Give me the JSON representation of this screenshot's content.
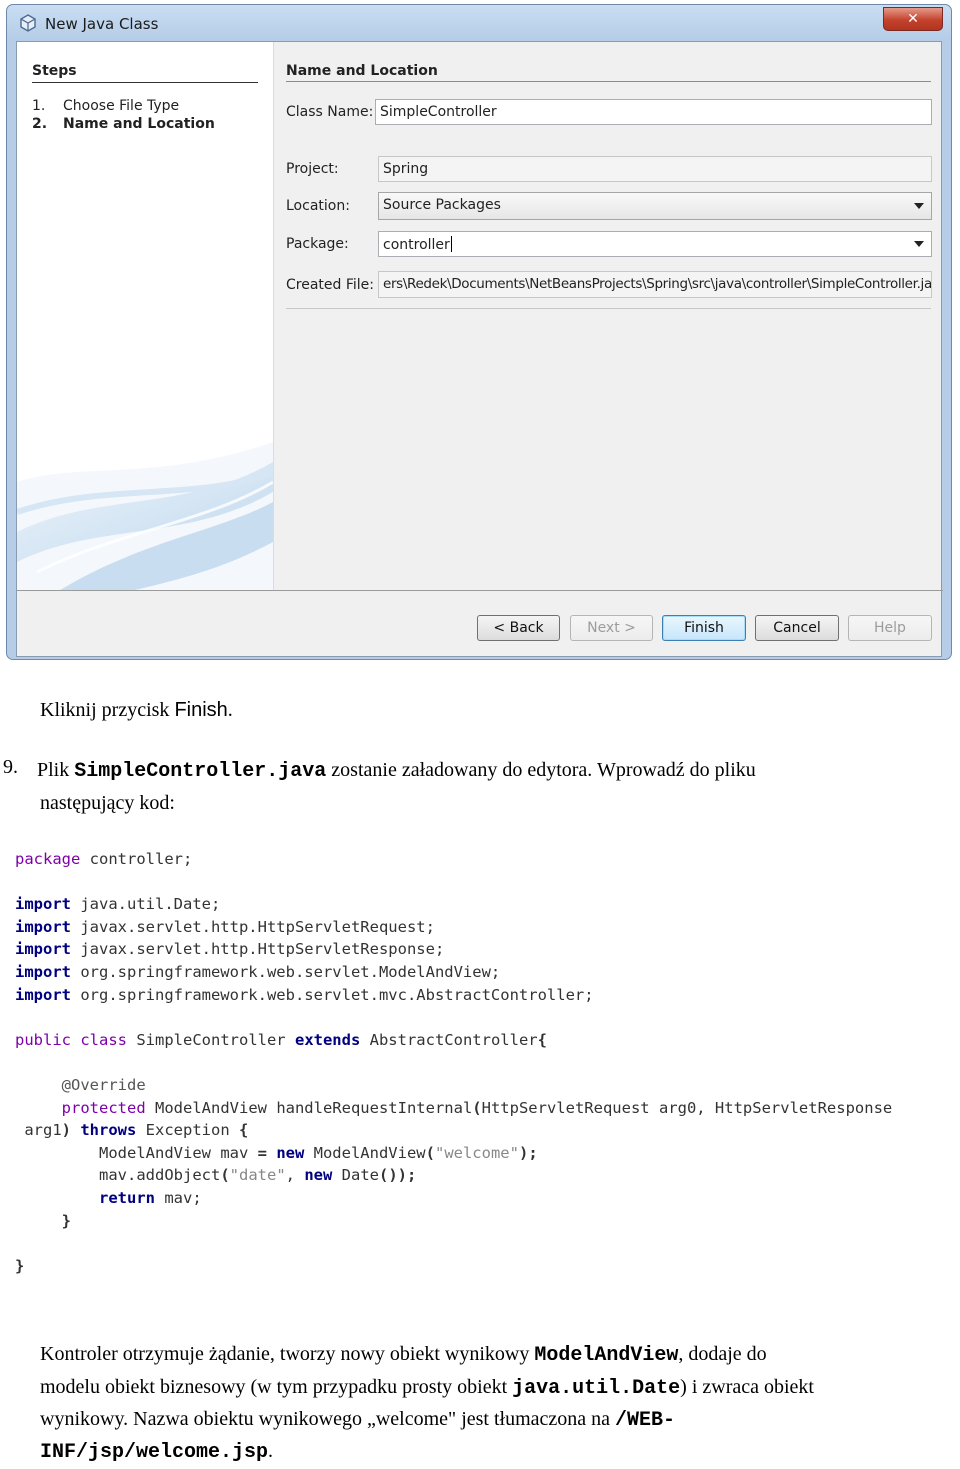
{
  "dialog": {
    "title": "New Java Class",
    "close_label": "✕",
    "steps_heading": "Steps",
    "steps": [
      {
        "num": "1.",
        "label": "Choose File Type"
      },
      {
        "num": "2.",
        "label": "Name and Location"
      }
    ],
    "section_heading": "Name and Location",
    "fields": {
      "class_name": {
        "label": "Class Name:",
        "value": "SimpleController"
      },
      "project": {
        "label": "Project:",
        "value": "Spring"
      },
      "location": {
        "label": "Location:",
        "value": "Source Packages"
      },
      "package": {
        "label": "Package:",
        "value": "controller"
      },
      "created_file": {
        "label": "Created File:",
        "value": "ers\\Redek\\Documents\\NetBeansProjects\\Spring\\src\\java\\controller\\SimpleController.java"
      }
    },
    "buttons": {
      "back": "< Back",
      "next": "Next >",
      "finish": "Finish",
      "cancel": "Cancel",
      "help": "Help"
    }
  },
  "doc": {
    "instruction_pre": "Kliknij przycisk ",
    "instruction_button": "Finish",
    "instruction_post": ".",
    "step_number": "9.",
    "step9_a": "Plik ",
    "step9_file": "SimpleController.java",
    "step9_b": " zostanie załadowany do edytora. Wprowadź do pliku",
    "step9_c": "następujący kod:",
    "code": {
      "l1_kw": "package",
      "l1_rest": " controller;",
      "import_kw": "import",
      "imports": [
        " java.util.Date;",
        " javax.servlet.http.HttpServletRequest;",
        " javax.servlet.http.HttpServletResponse;",
        " org.springframework.web.servlet.ModelAndView;",
        " org.springframework.web.servlet.mvc.AbstractController;"
      ],
      "cls_public": "public",
      "cls_class": " class",
      "cls_name": " SimpleController ",
      "cls_extends": "extends",
      "cls_parent": " AbstractController",
      "cls_brace": "{",
      "annotation": "@Override",
      "m_protected": "protected",
      "m_sig": " ModelAndView handleRequestInternal",
      "m_paren": "(",
      "m_params": "HttpServletRequest arg0, HttpServletResponse",
      "m_arg1": "arg1",
      "m_close": ")",
      "m_throws": " throws",
      "m_exc": " Exception ",
      "m_open": "{",
      "b1_a": "ModelAndView mav ",
      "b1_eq": "=",
      "b1_new": " new",
      "b1_b": " ModelAndView",
      "b1_po": "(",
      "b1_str": "\"welcome\"",
      "b1_end": ");",
      "b2_a": "mav.addObject",
      "b2_po": "(",
      "b2_str": "\"date\"",
      "b2_comma": ", ",
      "b2_new": "new",
      "b2_b": " Date",
      "b2_end": "());",
      "b3_return": "return",
      "b3_rest": " mav;",
      "close_method": "}",
      "close_class": "}"
    },
    "summary_1a": "Kontroler otrzymuje żądanie, tworzy nowy obiekt wynikowy ",
    "summary_1code": "ModelAndView",
    "summary_1b": ", dodaje do",
    "summary_2a": "modelu obiekt biznesowy (w tym przypadku prosty obiekt ",
    "summary_2code": "java.util.Date",
    "summary_2b": ") i zwraca obiekt",
    "summary_3a": "wynikowy. Nazwa obiektu wynikowego „welcome\" jest tłumaczona na ",
    "summary_3code": "/WEB-",
    "summary_4code": "INF/jsp/welcome.jsp",
    "summary_4b": "."
  }
}
